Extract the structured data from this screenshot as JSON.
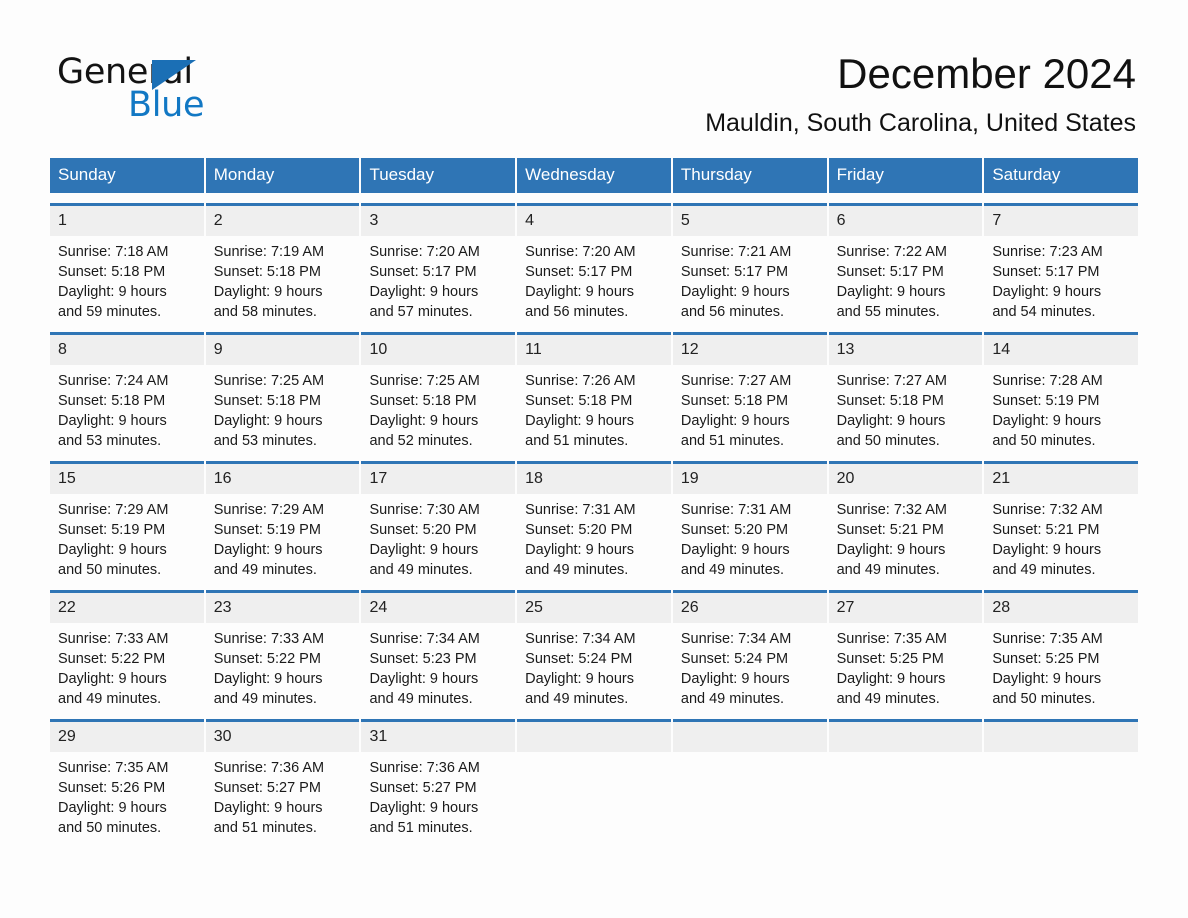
{
  "brand": {
    "name_part1": "General",
    "name_part2": "Blue",
    "triangle_icon": "triangle-icon",
    "accent_color": "#1278c4",
    "dark_color": "#131313"
  },
  "header": {
    "month_title": "December 2024",
    "location": "Mauldin, South Carolina, United States"
  },
  "calendar": {
    "header_bg": "#2f75b5",
    "day_band_bg": "#efefef",
    "weekdays": [
      "Sunday",
      "Monday",
      "Tuesday",
      "Wednesday",
      "Thursday",
      "Friday",
      "Saturday"
    ],
    "weeks": [
      [
        {
          "day": "1",
          "sunrise": "Sunrise: 7:18 AM",
          "sunset": "Sunset: 5:18 PM",
          "daylight_line1": "Daylight: 9 hours",
          "daylight_line2": "and 59 minutes."
        },
        {
          "day": "2",
          "sunrise": "Sunrise: 7:19 AM",
          "sunset": "Sunset: 5:18 PM",
          "daylight_line1": "Daylight: 9 hours",
          "daylight_line2": "and 58 minutes."
        },
        {
          "day": "3",
          "sunrise": "Sunrise: 7:20 AM",
          "sunset": "Sunset: 5:17 PM",
          "daylight_line1": "Daylight: 9 hours",
          "daylight_line2": "and 57 minutes."
        },
        {
          "day": "4",
          "sunrise": "Sunrise: 7:20 AM",
          "sunset": "Sunset: 5:17 PM",
          "daylight_line1": "Daylight: 9 hours",
          "daylight_line2": "and 56 minutes."
        },
        {
          "day": "5",
          "sunrise": "Sunrise: 7:21 AM",
          "sunset": "Sunset: 5:17 PM",
          "daylight_line1": "Daylight: 9 hours",
          "daylight_line2": "and 56 minutes."
        },
        {
          "day": "6",
          "sunrise": "Sunrise: 7:22 AM",
          "sunset": "Sunset: 5:17 PM",
          "daylight_line1": "Daylight: 9 hours",
          "daylight_line2": "and 55 minutes."
        },
        {
          "day": "7",
          "sunrise": "Sunrise: 7:23 AM",
          "sunset": "Sunset: 5:17 PM",
          "daylight_line1": "Daylight: 9 hours",
          "daylight_line2": "and 54 minutes."
        }
      ],
      [
        {
          "day": "8",
          "sunrise": "Sunrise: 7:24 AM",
          "sunset": "Sunset: 5:18 PM",
          "daylight_line1": "Daylight: 9 hours",
          "daylight_line2": "and 53 minutes."
        },
        {
          "day": "9",
          "sunrise": "Sunrise: 7:25 AM",
          "sunset": "Sunset: 5:18 PM",
          "daylight_line1": "Daylight: 9 hours",
          "daylight_line2": "and 53 minutes."
        },
        {
          "day": "10",
          "sunrise": "Sunrise: 7:25 AM",
          "sunset": "Sunset: 5:18 PM",
          "daylight_line1": "Daylight: 9 hours",
          "daylight_line2": "and 52 minutes."
        },
        {
          "day": "11",
          "sunrise": "Sunrise: 7:26 AM",
          "sunset": "Sunset: 5:18 PM",
          "daylight_line1": "Daylight: 9 hours",
          "daylight_line2": "and 51 minutes."
        },
        {
          "day": "12",
          "sunrise": "Sunrise: 7:27 AM",
          "sunset": "Sunset: 5:18 PM",
          "daylight_line1": "Daylight: 9 hours",
          "daylight_line2": "and 51 minutes."
        },
        {
          "day": "13",
          "sunrise": "Sunrise: 7:27 AM",
          "sunset": "Sunset: 5:18 PM",
          "daylight_line1": "Daylight: 9 hours",
          "daylight_line2": "and 50 minutes."
        },
        {
          "day": "14",
          "sunrise": "Sunrise: 7:28 AM",
          "sunset": "Sunset: 5:19 PM",
          "daylight_line1": "Daylight: 9 hours",
          "daylight_line2": "and 50 minutes."
        }
      ],
      [
        {
          "day": "15",
          "sunrise": "Sunrise: 7:29 AM",
          "sunset": "Sunset: 5:19 PM",
          "daylight_line1": "Daylight: 9 hours",
          "daylight_line2": "and 50 minutes."
        },
        {
          "day": "16",
          "sunrise": "Sunrise: 7:29 AM",
          "sunset": "Sunset: 5:19 PM",
          "daylight_line1": "Daylight: 9 hours",
          "daylight_line2": "and 49 minutes."
        },
        {
          "day": "17",
          "sunrise": "Sunrise: 7:30 AM",
          "sunset": "Sunset: 5:20 PM",
          "daylight_line1": "Daylight: 9 hours",
          "daylight_line2": "and 49 minutes."
        },
        {
          "day": "18",
          "sunrise": "Sunrise: 7:31 AM",
          "sunset": "Sunset: 5:20 PM",
          "daylight_line1": "Daylight: 9 hours",
          "daylight_line2": "and 49 minutes."
        },
        {
          "day": "19",
          "sunrise": "Sunrise: 7:31 AM",
          "sunset": "Sunset: 5:20 PM",
          "daylight_line1": "Daylight: 9 hours",
          "daylight_line2": "and 49 minutes."
        },
        {
          "day": "20",
          "sunrise": "Sunrise: 7:32 AM",
          "sunset": "Sunset: 5:21 PM",
          "daylight_line1": "Daylight: 9 hours",
          "daylight_line2": "and 49 minutes."
        },
        {
          "day": "21",
          "sunrise": "Sunrise: 7:32 AM",
          "sunset": "Sunset: 5:21 PM",
          "daylight_line1": "Daylight: 9 hours",
          "daylight_line2": "and 49 minutes."
        }
      ],
      [
        {
          "day": "22",
          "sunrise": "Sunrise: 7:33 AM",
          "sunset": "Sunset: 5:22 PM",
          "daylight_line1": "Daylight: 9 hours",
          "daylight_line2": "and 49 minutes."
        },
        {
          "day": "23",
          "sunrise": "Sunrise: 7:33 AM",
          "sunset": "Sunset: 5:22 PM",
          "daylight_line1": "Daylight: 9 hours",
          "daylight_line2": "and 49 minutes."
        },
        {
          "day": "24",
          "sunrise": "Sunrise: 7:34 AM",
          "sunset": "Sunset: 5:23 PM",
          "daylight_line1": "Daylight: 9 hours",
          "daylight_line2": "and 49 minutes."
        },
        {
          "day": "25",
          "sunrise": "Sunrise: 7:34 AM",
          "sunset": "Sunset: 5:24 PM",
          "daylight_line1": "Daylight: 9 hours",
          "daylight_line2": "and 49 minutes."
        },
        {
          "day": "26",
          "sunrise": "Sunrise: 7:34 AM",
          "sunset": "Sunset: 5:24 PM",
          "daylight_line1": "Daylight: 9 hours",
          "daylight_line2": "and 49 minutes."
        },
        {
          "day": "27",
          "sunrise": "Sunrise: 7:35 AM",
          "sunset": "Sunset: 5:25 PM",
          "daylight_line1": "Daylight: 9 hours",
          "daylight_line2": "and 49 minutes."
        },
        {
          "day": "28",
          "sunrise": "Sunrise: 7:35 AM",
          "sunset": "Sunset: 5:25 PM",
          "daylight_line1": "Daylight: 9 hours",
          "daylight_line2": "and 50 minutes."
        }
      ],
      [
        {
          "day": "29",
          "sunrise": "Sunrise: 7:35 AM",
          "sunset": "Sunset: 5:26 PM",
          "daylight_line1": "Daylight: 9 hours",
          "daylight_line2": "and 50 minutes."
        },
        {
          "day": "30",
          "sunrise": "Sunrise: 7:36 AM",
          "sunset": "Sunset: 5:27 PM",
          "daylight_line1": "Daylight: 9 hours",
          "daylight_line2": "and 51 minutes."
        },
        {
          "day": "31",
          "sunrise": "Sunrise: 7:36 AM",
          "sunset": "Sunset: 5:27 PM",
          "daylight_line1": "Daylight: 9 hours",
          "daylight_line2": "and 51 minutes."
        },
        {
          "day": "",
          "sunrise": "",
          "sunset": "",
          "daylight_line1": "",
          "daylight_line2": ""
        },
        {
          "day": "",
          "sunrise": "",
          "sunset": "",
          "daylight_line1": "",
          "daylight_line2": ""
        },
        {
          "day": "",
          "sunrise": "",
          "sunset": "",
          "daylight_line1": "",
          "daylight_line2": ""
        },
        {
          "day": "",
          "sunrise": "",
          "sunset": "",
          "daylight_line1": "",
          "daylight_line2": ""
        }
      ]
    ]
  }
}
